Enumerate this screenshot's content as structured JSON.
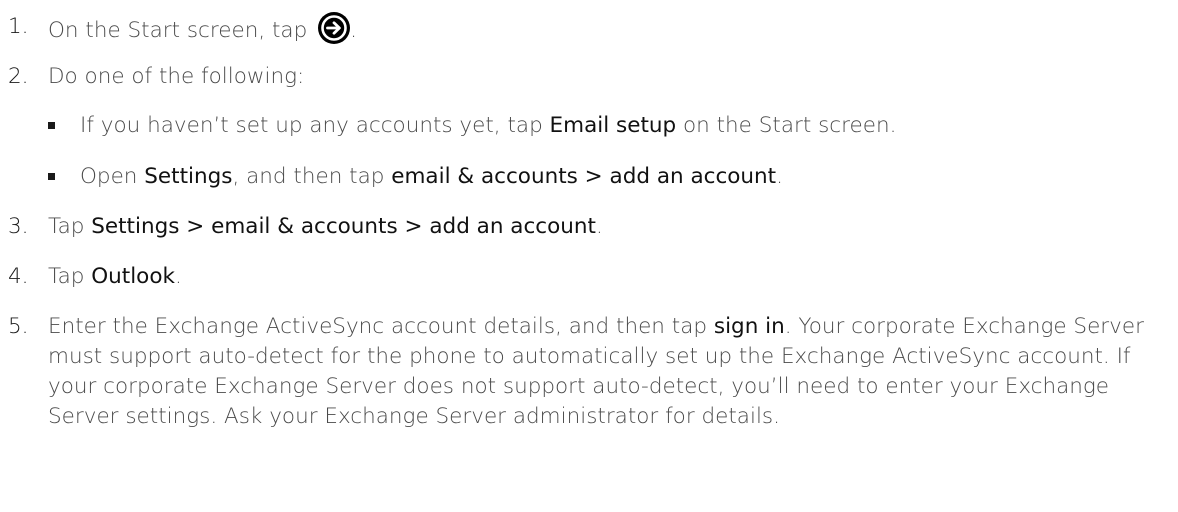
{
  "steps": [
    {
      "number": "1.",
      "before_icon": "On the Start screen, tap",
      "icon": "arrow-right-circle-icon",
      "after_icon": "."
    },
    {
      "number": "2.",
      "text": "Do one of the following:",
      "bullets": [
        {
          "parts": [
            "If you haven’t set up any accounts yet, tap ",
            "Email setup",
            " on the Start screen."
          ]
        },
        {
          "parts": [
            "Open ",
            "Settings",
            ", and then tap ",
            "email & accounts > add an account",
            "."
          ]
        }
      ]
    },
    {
      "number": "3.",
      "parts": [
        "Tap ",
        "Settings > email & accounts > add an account",
        "."
      ]
    },
    {
      "number": "4.",
      "parts": [
        "Tap ",
        "Outlook",
        "."
      ]
    },
    {
      "number": "5.",
      "parts": [
        "Enter the Exchange ActiveSync account details, and then tap ",
        "sign in",
        ". Your corporate Exchange Server must support auto-detect for the phone to automatically set up the Exchange ActiveSync account. If your corporate Exchange Server does not support auto-detect, you’ll need to enter your Exchange Server settings. Ask your Exchange Server administrator for details."
      ]
    }
  ]
}
